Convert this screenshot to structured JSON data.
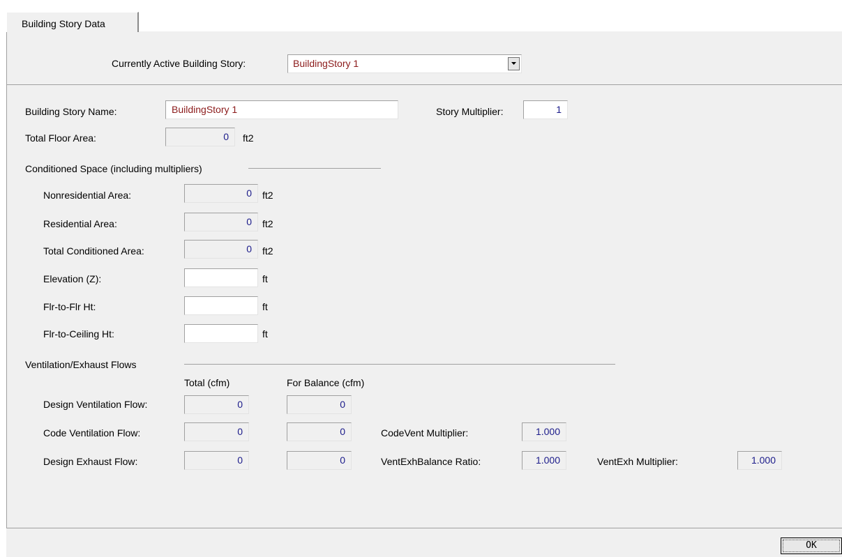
{
  "tab": {
    "label": "Building Story Data"
  },
  "active_story": {
    "label": "Currently Active Building Story:",
    "value": "BuildingStory 1"
  },
  "story_name": {
    "label": "Building Story Name:",
    "value": "BuildingStory 1"
  },
  "story_multiplier": {
    "label": "Story Multiplier:",
    "value": "1"
  },
  "total_floor_area": {
    "label": "Total Floor Area:",
    "value": "0",
    "unit": "ft2"
  },
  "conditioned": {
    "heading": "Conditioned Space (including multipliers)",
    "nonres": {
      "label": "Nonresidential Area:",
      "value": "0",
      "unit": "ft2"
    },
    "res": {
      "label": "Residential Area:",
      "value": "0",
      "unit": "ft2"
    },
    "total": {
      "label": "Total Conditioned Area:",
      "value": "0",
      "unit": "ft2"
    },
    "elevation": {
      "label": "Elevation (Z):",
      "value": "",
      "unit": "ft"
    },
    "flr_to_flr": {
      "label": "Flr-to-Flr Ht:",
      "value": "",
      "unit": "ft"
    },
    "flr_to_ceiling": {
      "label": "Flr-to-Ceiling Ht:",
      "value": "",
      "unit": "ft"
    }
  },
  "ventilation": {
    "heading": "Ventilation/Exhaust Flows",
    "col_total": "Total (cfm)",
    "col_balance": "For Balance (cfm)",
    "design_vent": {
      "label": "Design Ventilation Flow:",
      "total": "0",
      "balance": "0"
    },
    "code_vent": {
      "label": "Code Ventilation Flow:",
      "total": "0",
      "balance": "0"
    },
    "design_exh": {
      "label": "Design Exhaust Flow:",
      "total": "0",
      "balance": "0"
    },
    "codevent_mult": {
      "label": "CodeVent Multiplier:",
      "value": "1.000"
    },
    "ventexh_balance": {
      "label": "VentExhBalance Ratio:",
      "value": "1.000"
    },
    "ventexh_mult": {
      "label": "VentExh Multiplier:",
      "value": "1.000"
    }
  },
  "ok_button": {
    "label": "OK"
  },
  "colors": {
    "panel_bg": "#f0f0f0",
    "value_text": "#1b1b8a",
    "name_text": "#8b1a1a"
  }
}
